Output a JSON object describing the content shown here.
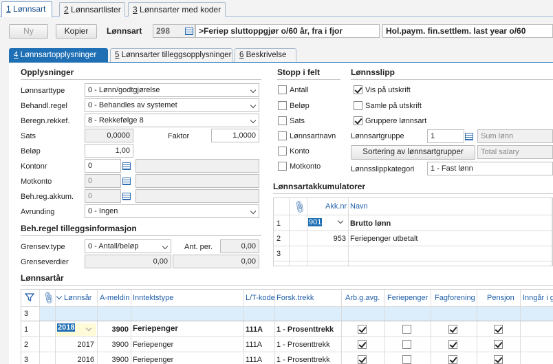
{
  "top_tabs": [
    {
      "num": "1",
      "label": "Lønnsart"
    },
    {
      "num": "2",
      "label": "Lønnsartlister"
    },
    {
      "num": "3",
      "label": "Lønnsarter med koder"
    }
  ],
  "toolbar": {
    "new_label": "Ny",
    "copy_label": "Kopier",
    "lonnsart_label": "Lønnsart",
    "lonnsart_number": "298",
    "lonnsart_name": ">Feriep sluttoppgjør o/60 år, fra i fjor",
    "lonnsart_name_en": "Hol.paym. fin.settlem. last year o/60"
  },
  "sub_tabs": [
    {
      "num": "4",
      "label": "Lønnsartopplysninger"
    },
    {
      "num": "5",
      "label": "Lønnsarter tilleggsopplysninger"
    },
    {
      "num": "6",
      "label": "Beskrivelse"
    }
  ],
  "opplysninger": {
    "title": "Opplysninger",
    "lonnsarttype_label": "Lønnsarttype",
    "lonnsarttype_value": "0 - Lønn/godtgjørelse",
    "behandl_label": "Behandl.regel",
    "behandl_value": "0 - Behandles av systemet",
    "beregn_label": "Beregn.rekkef.",
    "beregn_value": "8 - Rekkefølge 8",
    "sats_label": "Sats",
    "sats_value": "0,0000",
    "faktor_label": "Faktor",
    "faktor_value": "1,0000",
    "belop_label": "Beløp",
    "belop_value": "1,00",
    "kontonr_label": "Kontonr",
    "kontonr_value": "0",
    "motkonto_label": "Motkonto",
    "motkonto_value": "0",
    "behreg_label": "Beh.reg.akkum.",
    "behreg_value": "0",
    "avrunding_label": "Avrunding",
    "avrunding_value": "0 - Ingen"
  },
  "beh_regel": {
    "title": "Beh.regel tilleggsinformasjon",
    "grensev_type_label": "Grensev.type",
    "grensev_type_value": "0 - Antall/beløp",
    "ant_per_label": "Ant. per.",
    "ant_per_value": "0,00",
    "grenseverdier_label": "Grenseverdier",
    "grenseverdi_1": "0,00",
    "grenseverdi_2": "0,00"
  },
  "stopp_i_felt": {
    "title": "Stopp i felt",
    "items": [
      {
        "label": "Antall",
        "checked": false
      },
      {
        "label": "Beløp",
        "checked": false
      },
      {
        "label": "Sats",
        "checked": false
      },
      {
        "label": "Lønnsartnavn",
        "checked": false
      },
      {
        "label": "Konto",
        "checked": false
      },
      {
        "label": "Motkonto",
        "checked": false
      }
    ]
  },
  "lonnsslipp": {
    "title": "Lønnsslipp",
    "vis_label": "Vis på utskrift",
    "vis_checked": true,
    "samle_label": "Samle på utskrift",
    "samle_checked": false,
    "gruppere_label": "Gruppere lønnsart",
    "gruppere_checked": true,
    "gruppe_label": "Lønnsartgruppe",
    "gruppe_value": "1",
    "gruppe_name": "Sum lønn",
    "sortering_button": "Sortering av lønnsartgrupper",
    "sortering_name": "Total salary",
    "kategori_label": "Lønnsslippkategori",
    "kategori_value": "1 - Fast lønn"
  },
  "akkumulatorer": {
    "title": "Lønnsartakkumulatorer",
    "col_akknr": "Akk.nr",
    "col_navn": "Navn",
    "rows": [
      {
        "num": "1",
        "akknr": "901",
        "navn": "Brutto lønn"
      },
      {
        "num": "2",
        "akknr": "953",
        "navn": "Feriepenger utbetalt"
      },
      {
        "num": "3",
        "akknr": "",
        "navn": ""
      }
    ]
  },
  "lonnsartar": {
    "title": "Lønnsartår",
    "columns": [
      "Lønnsår",
      "A-meldin",
      "Inntektstype",
      "L/T-kode",
      "Forsk.trekk",
      "Arb.g.avg.",
      "Feriepenger",
      "Fagforening",
      "Pensjon",
      "Inngår i g"
    ],
    "filter_row_num": "3",
    "rows": [
      {
        "num": "1",
        "year": "2018",
        "ameld": "3900",
        "inntekt": "Feriepenger",
        "lt": "111A",
        "forsk": "1 - Prosenttrekk",
        "arbg": true,
        "ferie": false,
        "fag": true,
        "pensjon": true
      },
      {
        "num": "2",
        "year": "2017",
        "ameld": "3900",
        "inntekt": "Feriepenger",
        "lt": "111A",
        "forsk": "1 - Prosenttrekk",
        "arbg": true,
        "ferie": false,
        "fag": true,
        "pensjon": true
      },
      {
        "num": "3",
        "year": "2016",
        "ameld": "3900",
        "inntekt": "Feriepenger",
        "lt": "111A",
        "forsk": "1 - Prosenttrekk",
        "arbg": true,
        "ferie": false,
        "fag": true,
        "pensjon": true
      }
    ]
  },
  "colors": {
    "accent": "#1f6fb5",
    "header_text": "#1f5fa8",
    "filter_row": "#dceefb"
  }
}
